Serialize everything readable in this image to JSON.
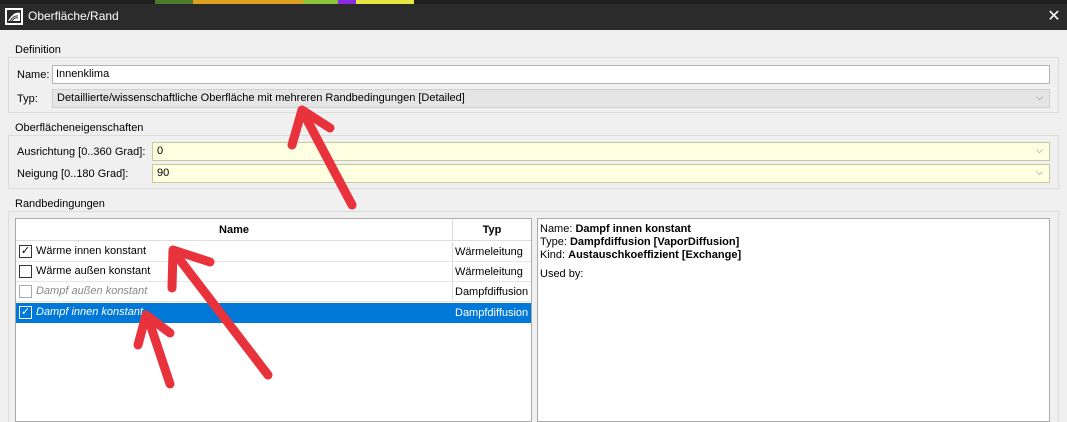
{
  "window": {
    "title": "Oberfläche/Rand",
    "close_glyph": "✕",
    "icon": "app-logo-icon"
  },
  "colors": {
    "accent": "#0078d7",
    "arrow": "#e8333c",
    "field_yellow": "#ffffe1"
  },
  "definition": {
    "group_label": "Definition",
    "name_label": "Name:",
    "name_value": "Innenklima",
    "type_label": "Typ:",
    "type_value": "Detaillierte/wissenschaftliche Oberfläche mit mehreren Randbedingungen [Detailed]"
  },
  "surface": {
    "group_label": "Oberflächeneigenschaften",
    "orientation_label": "Ausrichtung [0..360 Grad]:",
    "orientation_value": "0",
    "inclination_label": "Neigung [0..180 Grad]:",
    "inclination_value": "90"
  },
  "boundary": {
    "group_label": "Randbedingungen",
    "col_name": "Name",
    "col_type": "Typ",
    "rows": [
      {
        "name": "Wärme innen konstant",
        "type": "Wärmeleitung",
        "checked": true
      },
      {
        "name": "Wärme außen konstant",
        "type": "Wärmeleitung",
        "checked": false
      },
      {
        "name": "Dampf außen konstant",
        "type": "Dampfdiffusion",
        "checked": false
      },
      {
        "name": "Dampf innen konstant",
        "type": "Dampfdiffusion",
        "checked": true
      }
    ]
  },
  "info": {
    "name_key": "Name: ",
    "name_val": "Dampf innen konstant",
    "type_key": "Type: ",
    "type_val": "Dampfdiffusion [VaporDiffusion]",
    "kind_key": "Kind: ",
    "kind_val": "Austauschkoeffizient [Exchange]",
    "used_by": "Used by:"
  },
  "glyphs": {
    "check": "✓",
    "chevron": "⌵"
  }
}
